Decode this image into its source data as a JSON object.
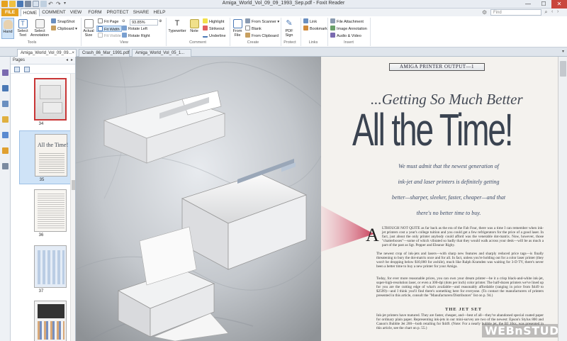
{
  "window": {
    "title": "Amiga_World_Vol_09_09_1993_Sep.pdf - Foxit Reader",
    "minimize": "—",
    "maximize": "☐",
    "close": "✕"
  },
  "menu": {
    "tabs": [
      "FILE",
      "HOME",
      "COMMENT",
      "VIEW",
      "FORM",
      "PROTECT",
      "SHARE",
      "HELP"
    ],
    "active_tab": "HOME",
    "find_placeholder": "Find"
  },
  "ribbon": {
    "tools": {
      "hand": "Hand",
      "select_text": "Select Text",
      "select_annotation": "Select Annotation",
      "label": "Tools"
    },
    "snapshot": "SnapShot",
    "clipboard": "Clipboard",
    "actual_size": "Actual Size",
    "view": {
      "fit_page": "Fit Page",
      "fit_width": "Fit Width",
      "fit_visible": "Fit Visible",
      "zoom": "93.85%",
      "rotate_left": "Rotate Left",
      "rotate_right": "Rotate Right",
      "label": "View"
    },
    "comment": {
      "typewriter": "Typewriter",
      "note": "Note",
      "highlight": "Highlight",
      "strikeout": "Strikeout",
      "underline": "Underline",
      "label": "Comment"
    },
    "create": {
      "from_file": "From File",
      "from_scanner": "From Scanner",
      "blank": "Blank",
      "from_clipboard": "From Clipboard",
      "label": "Create"
    },
    "protect": {
      "pdf_sign": "PDF Sign",
      "label": "Protect"
    },
    "links": {
      "link": "Link",
      "bookmark": "Bookmark",
      "label": "Links"
    },
    "insert": {
      "file_attachment": "File Attachment",
      "image_annotation": "Image Annotation",
      "audio_video": "Audio & Video",
      "label": "Insert"
    }
  },
  "doc_tabs": [
    "Amiga_World_Vol_09_09...",
    "Crash_86_Mar_1991.pdf",
    "Amiga_World_Vol_05_1..."
  ],
  "pages_panel": {
    "title": "Pages",
    "thumbnails": [
      "34",
      "35",
      "36",
      "37"
    ],
    "selected": "35"
  },
  "article": {
    "banner": "AMIGA PRINTER OUTPUT—1",
    "headline_small": "...Getting So Much Better",
    "headline_big": "All the Time!",
    "deck_lines": [
      "We must admit that the newest generation of",
      "ink-jet and laser printers is definitely getting",
      "better—sharper, sleeker, faster, cheaper—and that",
      "there's no better time to buy."
    ],
    "dropcap": "A",
    "body_p1": "LTHOUGH NOT QUITE as far back as the era of the Fab Four, there was a time I can remember when ink-jet printers cost a year's college tuition and you could get a few refrigerators for the price of a good laser. In fact, just about the only printer anybody could afford was the venerable dot-matrix. Now, however, those \"chatterboxes\"—some of which vibrated so badly that they would walk across your desk—will be as much a part of the past as Sgt. Pepper and Eleanor Rigby.",
    "body_p2": "The newest crop of ink-jets and lasers—with sharp new features and sharply reduced price tags—is finally threatening to bury the dot-matrix once and for all. In fact, unless you're holding out for a color laser printer (they won't be dropping below $10,000 for awhile), much like Ralph Kramden was waiting for 3-D TV, there's never been a better time to buy a new printer for your Amiga.",
    "body_p3": "Today, for ever more reasonable prices, you can own your dream printer—be it a crisp black-and-white ink-jet, super-high-resolution laser, or even a 300-dpi (dots per inch) color printer. The half-dozen printers we've lined up for you are the cutting edge of what's available—and reasonably affordable (ranging in price from $449 to $2599)—and I think you'll find there's something here for everyone. (To contact the manufacturers of printers presented in this article, consult the \"Manufacturers/Distributors\" list on p. 94.)",
    "subhead": "THE JET SET",
    "body_p4": "Ink-jet printers have matured. They are faster, cheaper, and—best of all—they've abandoned special coated paper for ordinary plain paper. Representing ink-jets in our mini-survey are two of the newest: Epson's Stylus 800 and Canon's Bubble Jet 200—both retailing for $449. (Note: For a nearly bubble jet, the BJ 10sx, was presented in this article, see the chart on p. 55.)"
  },
  "watermark": "WEBnSTUDY.com",
  "colors": {
    "file_tab": "#e5a21f",
    "selection": "#cfe3f7",
    "close_button": "#c9463d",
    "headline": "#3a4350"
  }
}
